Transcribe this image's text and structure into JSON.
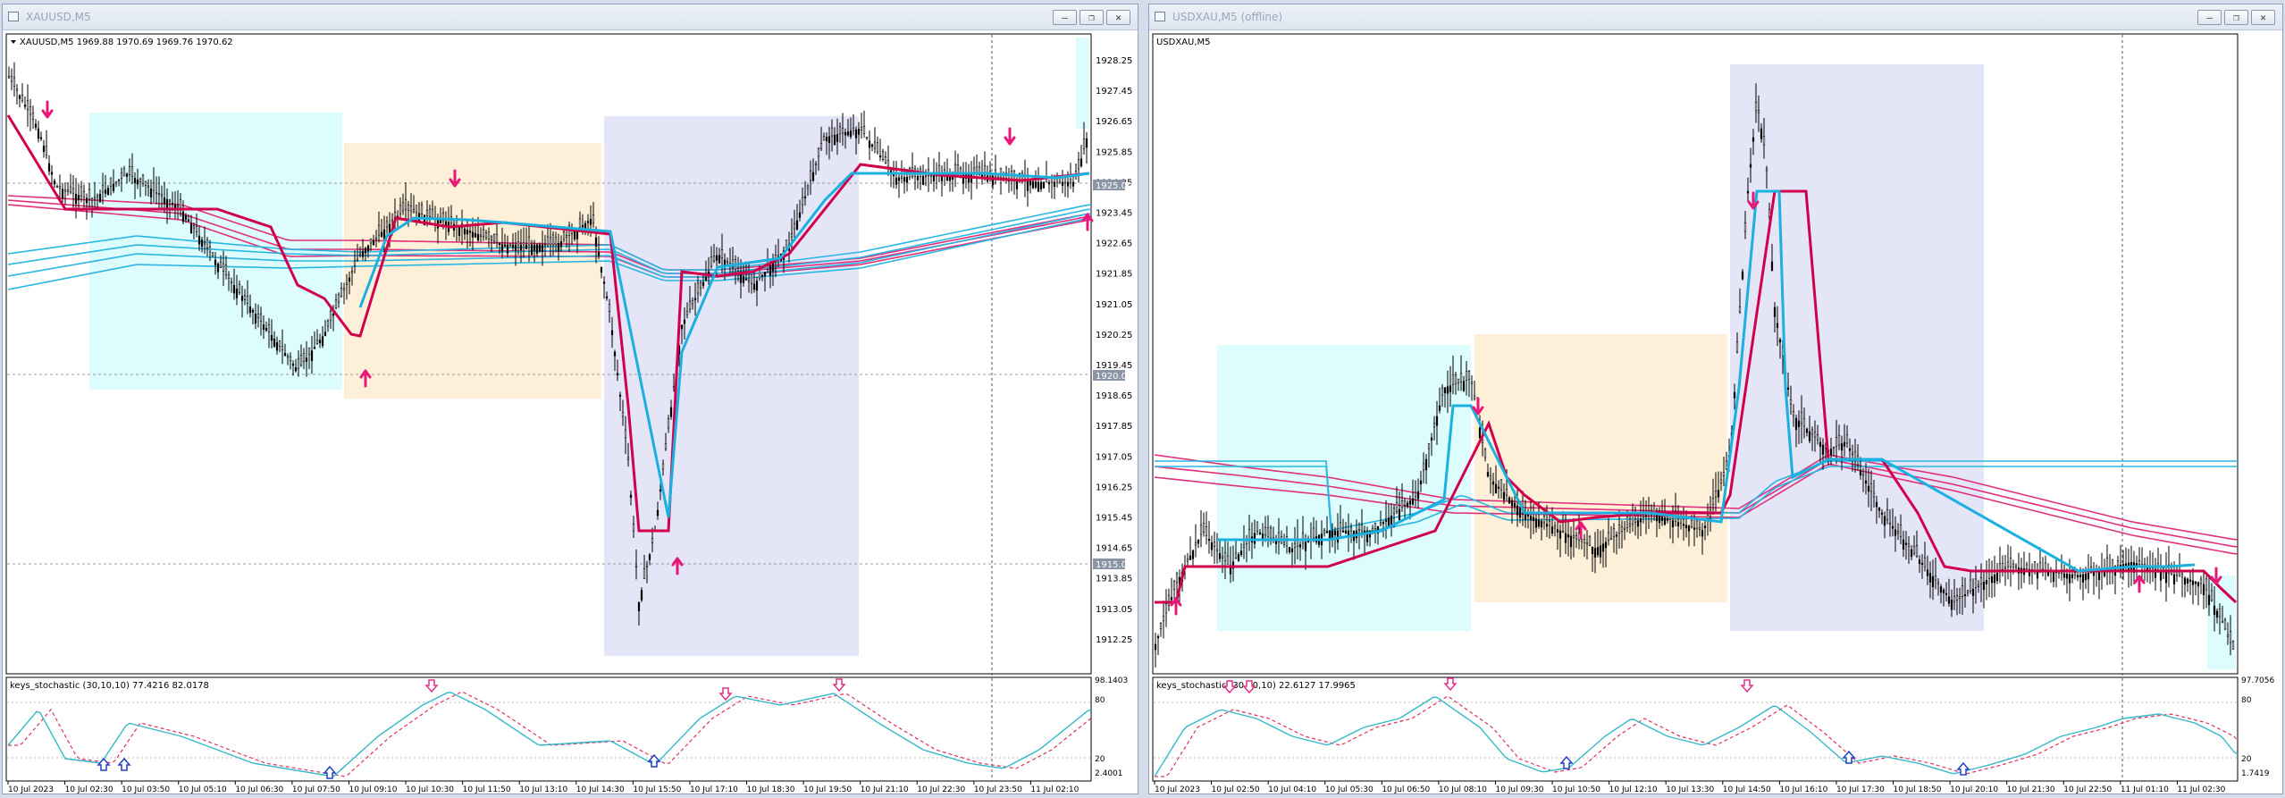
{
  "windows": [
    {
      "title": "XAUUSD,M5",
      "header": "XAUUSD,M5  1969.88 1970.69 1969.76 1970.62",
      "y_ticks": [
        "1928.25",
        "1927.45",
        "1926.65",
        "1925.85",
        "1924.25",
        "1923.45",
        "1922.65",
        "1921.85",
        "1921.05",
        "1920.25",
        "1919.45",
        "1918.65",
        "1917.85",
        "1917.05",
        "1916.25",
        "1915.45",
        "1914.65",
        "1913.85",
        "1913.05",
        "1912.25"
      ],
      "price_tags": [
        "1925.00",
        "1920.00",
        "1915.00"
      ],
      "indicator": {
        "label": "keys_stochastic (30,10,10) 77.4216 82.0178",
        "y_ticks": [
          "98.1403",
          "80",
          "20",
          "2.4001"
        ]
      },
      "x_ticks": [
        "10 Jul 2023",
        "10 Jul 02:30",
        "10 Jul 03:50",
        "10 Jul 05:10",
        "10 Jul 06:30",
        "10 Jul 07:50",
        "10 Jul 09:10",
        "10 Jul 10:30",
        "10 Jul 11:50",
        "10 Jul 13:10",
        "10 Jul 14:30",
        "10 Jul 15:50",
        "10 Jul 17:10",
        "10 Jul 18:30",
        "10 Jul 19:50",
        "10 Jul 21:10",
        "10 Jul 22:30",
        "10 Jul 23:50",
        "11 Jul 02:10"
      ]
    },
    {
      "title": "USDXAU,M5 (offline)",
      "header": "USDXAU,M5",
      "y_ticks": [],
      "price_tags": [],
      "indicator": {
        "label": "keys_stochastic (30,10,10) 22.6127 17.9965",
        "y_ticks": [
          "97.7056",
          "80",
          "20",
          "1.7419"
        ]
      },
      "x_ticks": [
        "10 Jul 2023",
        "10 Jul 02:50",
        "10 Jul 04:10",
        "10 Jul 05:30",
        "10 Jul 06:50",
        "10 Jul 08:10",
        "10 Jul 09:30",
        "10 Jul 10:50",
        "10 Jul 12:10",
        "10 Jul 13:30",
        "10 Jul 14:50",
        "10 Jul 16:10",
        "10 Jul 17:30",
        "10 Jul 18:50",
        "10 Jul 20:10",
        "10 Jul 21:30",
        "10 Jul 22:50",
        "11 Jul 01:10",
        "11 Jul 02:30"
      ]
    }
  ],
  "window_buttons": {
    "minimize": "–",
    "restore": "❐",
    "close": "✕"
  },
  "colors": {
    "zone_cyan": "#dcfcfe",
    "zone_orange": "#fdefd8",
    "zone_lavender": "#e5e5f8",
    "sell_line": "#d1004c",
    "buy_line": "#1ab0e0",
    "ema_magenta": "#e0307a",
    "ema_cyan": "#2ab6e2",
    "arrow": "#e8187a",
    "stoch_main": "#35b8c8",
    "stoch_signal": "#e03060"
  }
}
